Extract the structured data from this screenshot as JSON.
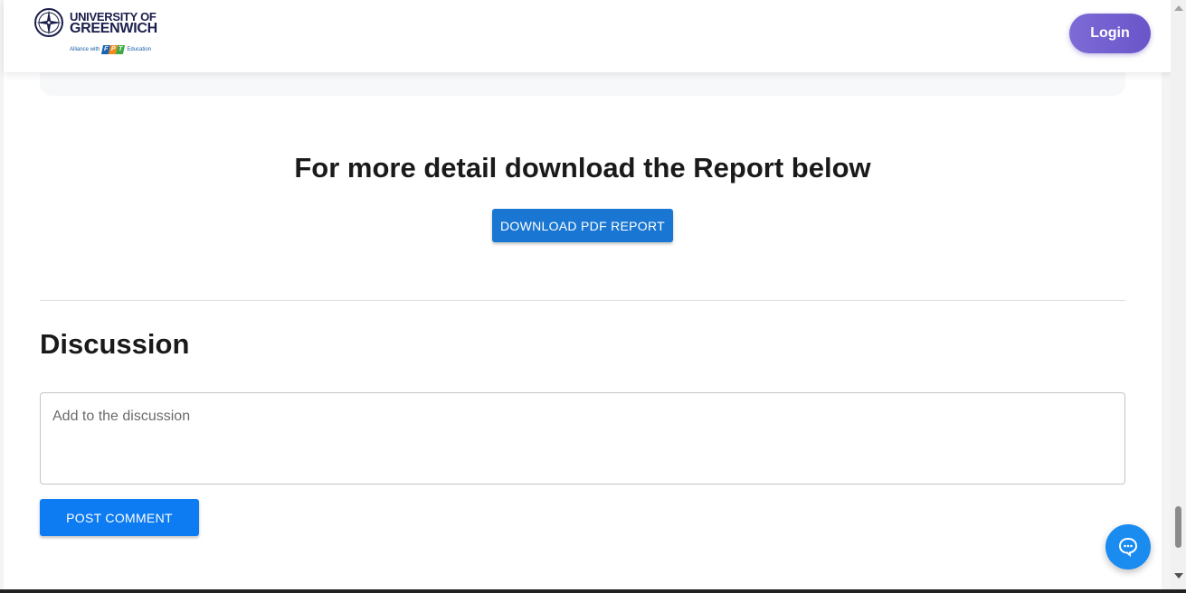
{
  "header": {
    "logo": {
      "line1": "UNIVERSITY OF",
      "line2": "GREENWICH",
      "alliance_prefix": "Alliance with",
      "fpt_letters": [
        "F",
        "P",
        "T"
      ],
      "alliance_suffix": "Education"
    },
    "login_label": "Login"
  },
  "report": {
    "title": "For more detail download the Report below",
    "download_label": "DOWNLOAD PDF REPORT"
  },
  "discussion": {
    "title": "Discussion",
    "input_placeholder": "Add to the discussion",
    "input_value": "",
    "post_label": "POST COMMENT"
  },
  "chat": {
    "icon": "chat-bubble-icon"
  },
  "colors": {
    "login_gradient_start": "#7d6bd6",
    "login_gradient_end": "#6a55c9",
    "download_button": "#1976d2",
    "post_button": "#0d7bf2",
    "chat_fab": "#1a8cf0",
    "brand_navy": "#1b1f4b",
    "fpt_blue": "#1b63b0",
    "fpt_orange": "#f08a1c",
    "fpt_green": "#3ea845"
  }
}
